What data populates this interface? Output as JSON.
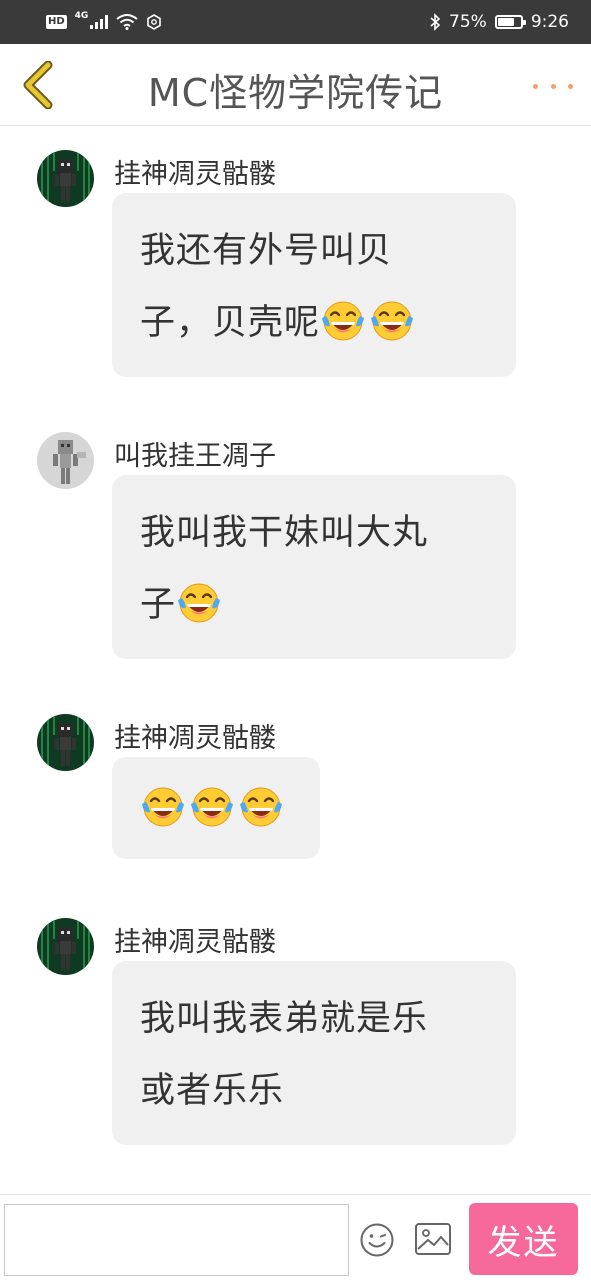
{
  "status_bar": {
    "left_badge": "HD",
    "network": "4G",
    "battery_text": "75%",
    "battery_level": 0.75,
    "time": "9:26",
    "icons": [
      "signal-icon",
      "wifi-icon",
      "sync-icon",
      "bluetooth-icon",
      "battery-icon"
    ]
  },
  "header": {
    "title": "MC怪物学院传记",
    "back_icon": "chevron-left-icon",
    "more_icon": "more-dots-icon",
    "accent_color": "#f4a06a",
    "back_color": "#e8c62f"
  },
  "messages": [
    {
      "sender": "挂神凋灵骷髅",
      "avatar": "wither-skeleton-avatar",
      "lines": [
        "我还有外号叫贝",
        "子，贝壳呢"
      ],
      "trailing_emoji": [
        "laughing-tears-emoji",
        "laughing-tears-emoji"
      ]
    },
    {
      "sender": "叫我挂王凋子",
      "avatar": "gray-skeleton-avatar",
      "lines": [
        "我叫我干妹叫大丸",
        "子"
      ],
      "trailing_emoji": [
        "laughing-tears-emoji"
      ]
    },
    {
      "sender": "挂神凋灵骷髅",
      "avatar": "wither-skeleton-avatar",
      "lines": [
        ""
      ],
      "trailing_emoji": [
        "laughing-tears-emoji",
        "laughing-tears-emoji",
        "laughing-tears-emoji"
      ]
    },
    {
      "sender": "挂神凋灵骷髅",
      "avatar": "wither-skeleton-avatar",
      "lines": [
        "我叫我表弟就是乐",
        "或者乐乐"
      ],
      "trailing_emoji": []
    }
  ],
  "input_bar": {
    "input_value": "",
    "emoji_icon": "smiley-icon",
    "image_icon": "image-icon",
    "send_label": "发送",
    "send_color": "#f7699b"
  }
}
